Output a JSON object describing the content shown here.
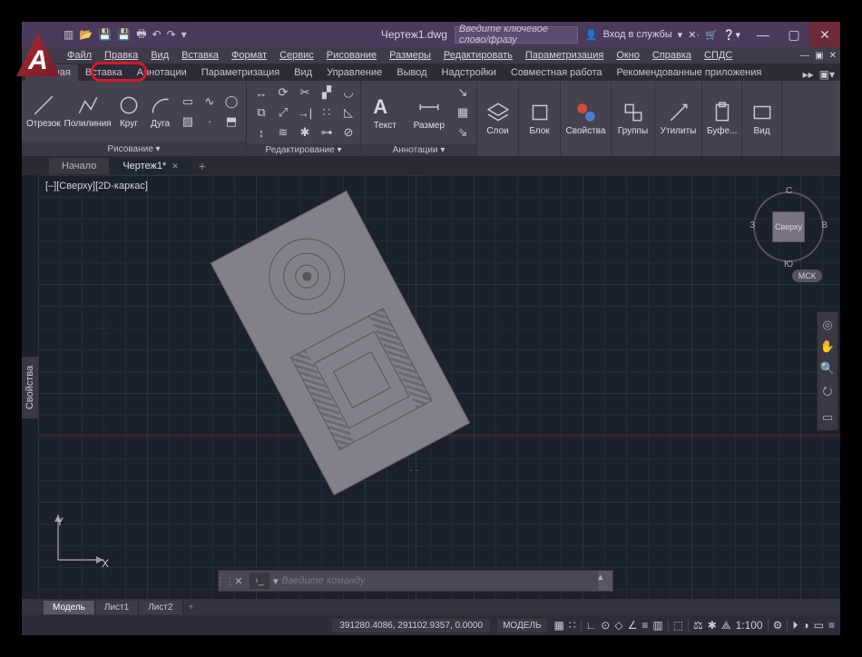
{
  "title": {
    "docname": "Чертеж1.dwg",
    "search_placeholder": "Введите ключевое слово/фразу",
    "services_label": "Вход в службы"
  },
  "menu": {
    "items": [
      "Файл",
      "Правка",
      "Вид",
      "Вставка",
      "Формат",
      "Сервис",
      "Рисование",
      "Размеры",
      "Редактировать",
      "Параметризация",
      "Окно",
      "Справка",
      "СПДС"
    ]
  },
  "ribbon_tabs": {
    "items": [
      "Главная",
      "Вставка",
      "Аннотации",
      "Параметризация",
      "Вид",
      "Управление",
      "Вывод",
      "Надстройки",
      "Совместная работа",
      "Рекомендованные приложения"
    ],
    "active": 0
  },
  "ribbon": {
    "draw": {
      "label": "Рисование ▾",
      "line": "Отрезок",
      "polyline": "Полилиния",
      "circle": "Круг",
      "arc": "Дуга"
    },
    "edit": {
      "label": "Редактирование ▾"
    },
    "annot": {
      "label": "Аннотации ▾",
      "text": "Текст",
      "dim": "Размер"
    },
    "layers": {
      "label": "Слои"
    },
    "block": {
      "label": "Блок"
    },
    "props": {
      "label": "Свойства"
    },
    "groups": {
      "label": "Группы"
    },
    "utils": {
      "label": "Утилиты"
    },
    "clip": {
      "label": "Буфе..."
    },
    "view": {
      "label": "Вид"
    }
  },
  "doctabs": {
    "items": [
      "Начало",
      "Чертеж1*"
    ],
    "active": 1
  },
  "workspace": {
    "side_tab": "Свойства",
    "view_label": "[–][Сверху][2D-каркас]",
    "cube_face": "Сверху",
    "compass": {
      "n": "С",
      "s": "Ю",
      "e": "В",
      "w": "З"
    },
    "coord_system": "МСК",
    "axis_x": "X",
    "axis_y": "Y",
    "cursor_mark": "˙ ˙"
  },
  "command": {
    "placeholder": "Введите команду"
  },
  "layout_tabs": {
    "items": [
      "Модель",
      "Лист1",
      "Лист2"
    ],
    "active": 0
  },
  "status": {
    "coords": "391280.4086, 291102.9357, 0.0000",
    "mode": "МОДЕЛЬ",
    "scale": "1:100"
  }
}
